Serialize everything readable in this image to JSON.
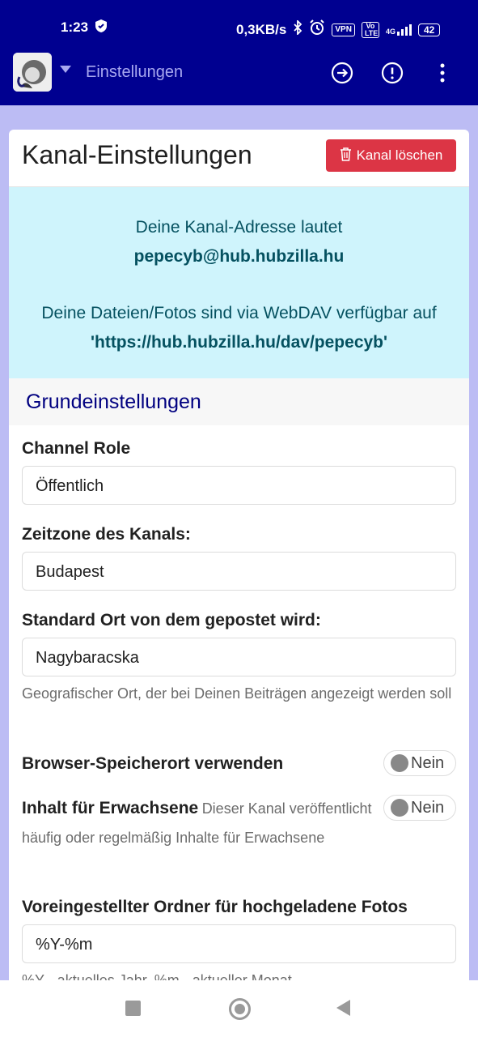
{
  "status": {
    "time": "1:23",
    "net_speed": "0,3KB/s",
    "vpn": "VPN",
    "volte": "Vo LTE",
    "network": "4G",
    "battery": "42"
  },
  "appbar": {
    "title": "Einstellungen"
  },
  "page": {
    "title": "Kanal-Einstellungen",
    "delete_label": "Kanal löschen"
  },
  "info": {
    "line1": "Deine Kanal-Adresse lautet",
    "address": "pepecyb@hub.hubzilla.hu",
    "line2": "Deine Dateien/Fotos sind via WebDAV verfügbar auf",
    "webdav": "'https://hub.hubzilla.hu/dav/pepecyb'"
  },
  "section": {
    "title": "Grundeinstellungen"
  },
  "fields": {
    "role_label": "Channel Role",
    "role_value": "Öffentlich",
    "timezone_label": "Zeitzone des Kanals:",
    "timezone_value": "Budapest",
    "location_label": "Standard Ort von dem gepostet wird:",
    "location_value": "Nagybaracska",
    "location_help": "Geografischer Ort, der bei Deinen Beiträgen angezeigt werden soll",
    "browser_label": "Browser-Speicherort verwenden",
    "browser_toggle": "Nein",
    "adult_label": "Inhalt für Erwachsene",
    "adult_desc": "Dieser Kanal veröffentlicht häufig oder regelmäßig Inhalte für Erwachsene",
    "adult_toggle": "Nein",
    "folder_label": "Voreingestellter Ordner für hochgeladene Fotos",
    "folder_value": "%Y-%m",
    "folder_help": "%Y - aktuelles Jahr, %m - aktueller Monat"
  },
  "colors": {
    "primary": "#000090",
    "danger": "#dc3545",
    "info_bg": "#cff4fc",
    "info_text": "#055160"
  }
}
